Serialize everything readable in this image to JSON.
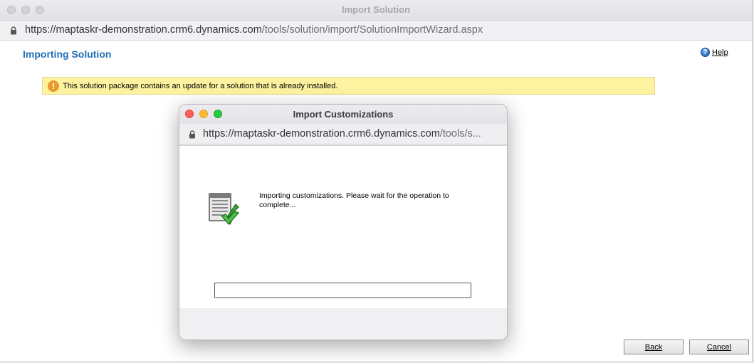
{
  "outer_window": {
    "title": "Import Solution",
    "url_host": "https://maptaskr-demonstration.crm6.dynamics.com",
    "url_path": "/tools/solution/import/SolutionImportWizard.aspx"
  },
  "page": {
    "title": "Importing Solution",
    "help_label": "Help",
    "help_icon": "help-icon",
    "warning_icon": "warning-icon",
    "warning_text": "This solution package contains an update for a solution that is already installed."
  },
  "dialog": {
    "title": "Import Customizations",
    "url_host": "https://maptaskr-demonstration.crm6.dynamics.com",
    "url_path": "/tools/s...",
    "icon": "import-customizations-icon",
    "message": "Importing customizations. Please wait for the operation to complete...",
    "progress": 0
  },
  "footer": {
    "back_label": "Back",
    "cancel_label": "Cancel"
  },
  "colors": {
    "accent": "#1f6fb5",
    "warning_bg": "#fdf2a0",
    "close": "#fe5f57",
    "minimize": "#febc2e",
    "zoom": "#28c840"
  }
}
